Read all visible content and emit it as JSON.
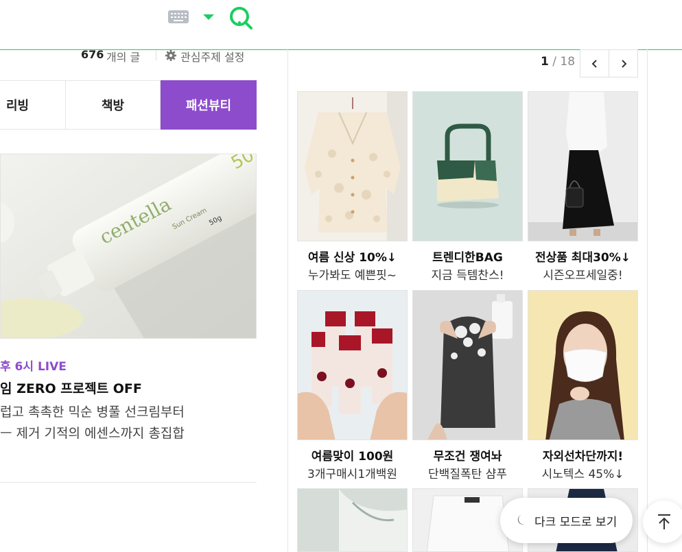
{
  "header": {
    "keyboard_icon": "keyboard-icon",
    "dropdown_icon": "caret-down-icon",
    "search_icon": "search-icon",
    "accent_color": "#19ce60"
  },
  "feed": {
    "count_number": "676",
    "count_unit": "개의 글",
    "interest_setting": "관심주제 설정",
    "tabs": [
      {
        "label": "리빙",
        "active": false
      },
      {
        "label": "책방",
        "active": false
      },
      {
        "label": "패션뷰티",
        "active": true
      }
    ],
    "active_color": "#8d4ccc",
    "article": {
      "live_label": "후 6시 LIVE",
      "title": "임 ZERO 프로젝트 OFF",
      "desc_line1": "럽고 촉촉한 믹순 병풀 선크림부터",
      "desc_line2": "ㅡ 제거 기적의 에센스까지 총집합",
      "image_text_brand": "centella",
      "image_text_product": "Sun Cream",
      "image_text_size": "50g",
      "image_text_spf": "50"
    }
  },
  "shopping": {
    "page_current": "1",
    "page_total": "/ 18",
    "cards": [
      {
        "title": "여름 신상 10%↓",
        "subtitle": "누가봐도 예쁜핏~"
      },
      {
        "title": "트렌디한BAG",
        "subtitle": "지금 득템찬스!"
      },
      {
        "title": "전상품 최대30%↓",
        "subtitle": "시즌오프세일중!"
      },
      {
        "title": "여름맞이 100원",
        "subtitle": "3개구매시1개백원"
      },
      {
        "title": "무조건 쟁여놔",
        "subtitle": "단백질폭탄 샴푸"
      },
      {
        "title": "자외선차단까지!",
        "subtitle": "시노텍스 45%↓"
      }
    ]
  },
  "floating": {
    "dark_mode_label": "다크 모드로 보기",
    "moon_icon": "moon-icon",
    "top_icon": "arrow-up-to-top-icon"
  }
}
